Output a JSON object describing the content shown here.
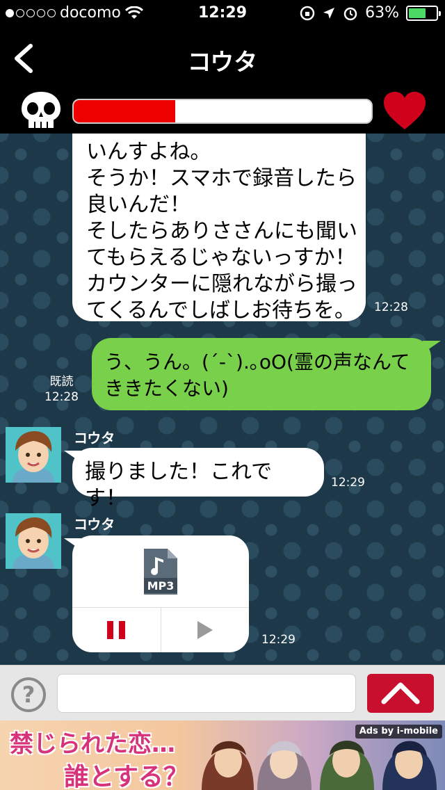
{
  "status_bar": {
    "carrier": "docomo",
    "time": "12:29",
    "battery": "63%",
    "battery_level": 0.63
  },
  "nav": {
    "title": "コウタ"
  },
  "meter": {
    "level": 0.34,
    "colors": {
      "fill": "#ee0000",
      "track": "#ffffff",
      "heart": "#d0021b"
    }
  },
  "messages": [
    {
      "side": "left",
      "lines": [
        "いんすよね。",
        "そうか！スマホで録音したら",
        "良いんだ！",
        "そしたらありささんにも聞い",
        "てもらえるじゃないっすか！",
        "カウンターに隠れながら撮っ",
        "てくるんでしばしお待ちを。"
      ],
      "time": "12:28"
    },
    {
      "side": "right",
      "lines": [
        "う、うん。(´-`).｡oO(霊の声なんて",
        "ききたくない)"
      ],
      "read_label": "既読",
      "time": "12:28"
    },
    {
      "side": "left",
      "sender": "コウタ",
      "text": "撮りました！これです！",
      "time": "12:29"
    },
    {
      "side": "left",
      "sender": "コウタ",
      "file_label": "MP3",
      "time": "12:29"
    }
  ],
  "input_bar": {
    "help_label": "?",
    "placeholder": ""
  },
  "ad": {
    "line1": "禁じられた恋…",
    "line2": "誰とする？",
    "tag": "Ads by i-mobile"
  },
  "icons": [
    "signal-dots-icon",
    "wifi-icon",
    "rotation-lock-icon",
    "location-icon",
    "alarm-icon",
    "battery-icon",
    "back-chevron-icon",
    "skull-icon",
    "heart-icon",
    "mp3-file-icon",
    "pause-icon",
    "play-icon",
    "help-icon",
    "send-up-icon"
  ]
}
